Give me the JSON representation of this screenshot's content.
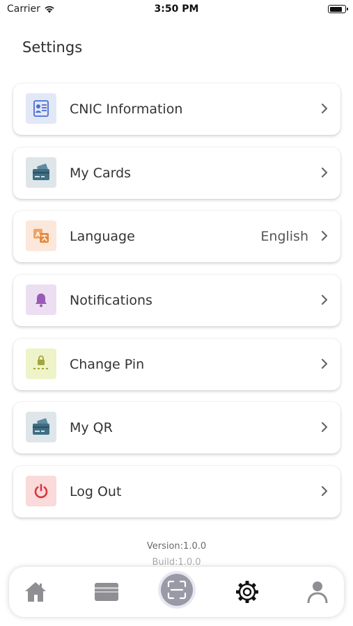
{
  "status_bar": {
    "carrier": "Carrier",
    "time": "3:50 PM",
    "battery_level": 0.9
  },
  "page": {
    "title": "Settings"
  },
  "settings": [
    {
      "label": "CNIC Information",
      "value": "",
      "icon": "id-card-icon",
      "icon_bg": "#e3e8f7",
      "icon_color": "#4a6fd1"
    },
    {
      "label": "My Cards",
      "value": "",
      "icon": "card-wallet-icon",
      "icon_bg": "#dfe6ea",
      "icon_color": "#3f6f84"
    },
    {
      "label": "Language",
      "value": "English",
      "icon": "translate-icon",
      "icon_bg": "#fbe8da",
      "icon_color": "#e8893d"
    },
    {
      "label": "Notifications",
      "value": "",
      "icon": "bell-icon",
      "icon_bg": "#ecdff2",
      "icon_color": "#9a5bb8"
    },
    {
      "label": "Change Pin",
      "value": "",
      "icon": "pin-lock-icon",
      "icon_bg": "#eef3c9",
      "icon_color": "#a2a63c"
    },
    {
      "label": "My QR",
      "value": "",
      "icon": "card-wallet-icon",
      "icon_bg": "#dfe6ea",
      "icon_color": "#3f6f84"
    },
    {
      "label": "Log Out",
      "value": "",
      "icon": "power-icon",
      "icon_bg": "#fadada",
      "icon_color": "#d9363e"
    }
  ],
  "footer": {
    "version": "Version:1.0.0",
    "build": "Build:1.0.0"
  },
  "tab_bar": {
    "tabs": [
      "home-icon",
      "wallet-icon",
      "scan-icon",
      "settings-gear-icon",
      "profile-icon"
    ],
    "active": "settings-gear-icon"
  }
}
